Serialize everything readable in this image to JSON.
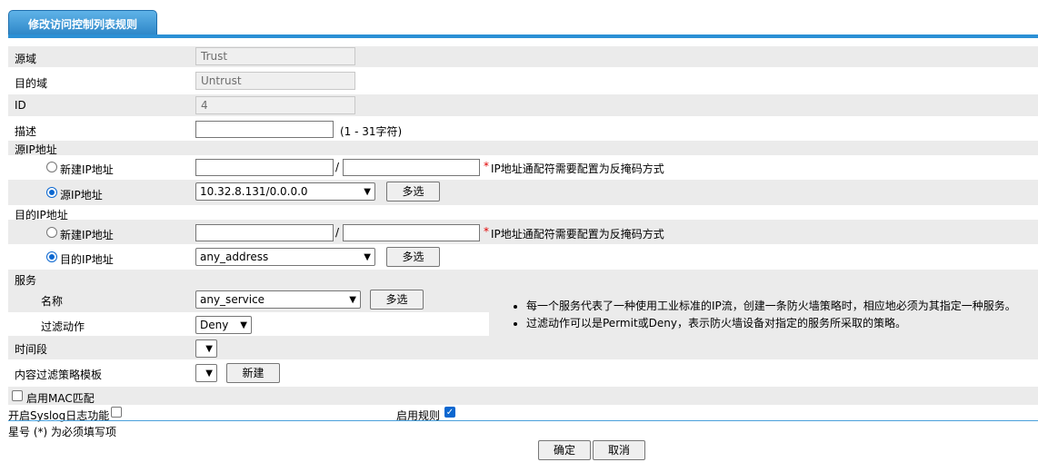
{
  "tab": {
    "title": "修改访问控制列表规则"
  },
  "src_zone": {
    "label": "源域",
    "value": "Trust"
  },
  "dst_zone": {
    "label": "目的域",
    "value": "Untrust"
  },
  "id": {
    "label": "ID",
    "value": "4"
  },
  "desc": {
    "label": "描述",
    "value": "",
    "hint": "(1 - 31字符)"
  },
  "src_ip": {
    "section": "源IP地址",
    "new_label": "新建IP地址",
    "separator": "/",
    "required_mark": "*",
    "note": "IP地址通配符需要配置为反掩码方式",
    "existing_label": "源IP地址",
    "selected": "10.32.8.131/0.0.0.0",
    "multi_button": "多选"
  },
  "dst_ip": {
    "section": "目的IP地址",
    "new_label": "新建IP地址",
    "separator": "/",
    "required_mark": "*",
    "note": "IP地址通配符需要配置为反掩码方式",
    "existing_label": "目的IP地址",
    "selected": "any_address",
    "multi_button": "多选"
  },
  "service": {
    "section": "服务",
    "name_label": "名称",
    "name_selected": "any_service",
    "multi_button": "多选",
    "filter_label": "过滤动作",
    "filter_selected": "Deny",
    "tips": [
      "每一个服务代表了一种使用工业标准的IP流，创建一条防火墙策略时，相应地必须为其指定一种服务。",
      "过滤动作可以是Permit或Deny，表示防火墙设备对指定的服务所采取的策略。"
    ]
  },
  "time_range": {
    "label": "时间段",
    "selected": ""
  },
  "content_filter": {
    "label": "内容过滤策略模板",
    "selected": "",
    "new_button": "新建"
  },
  "mac_match": {
    "label": "启用MAC匹配",
    "checked": false
  },
  "syslog": {
    "label": "开启Syslog日志功能",
    "checked": false
  },
  "enable_rule": {
    "label": "启用规则",
    "checked": true
  },
  "footer": {
    "required_note": "星号 (*) 为必须填写项",
    "ok": "确定",
    "cancel": "取消"
  },
  "colors": {
    "accent": "#2b90d5",
    "radio_selected": "#0b67d0",
    "required": "#e00000",
    "row_shade": "#ebebeb"
  }
}
